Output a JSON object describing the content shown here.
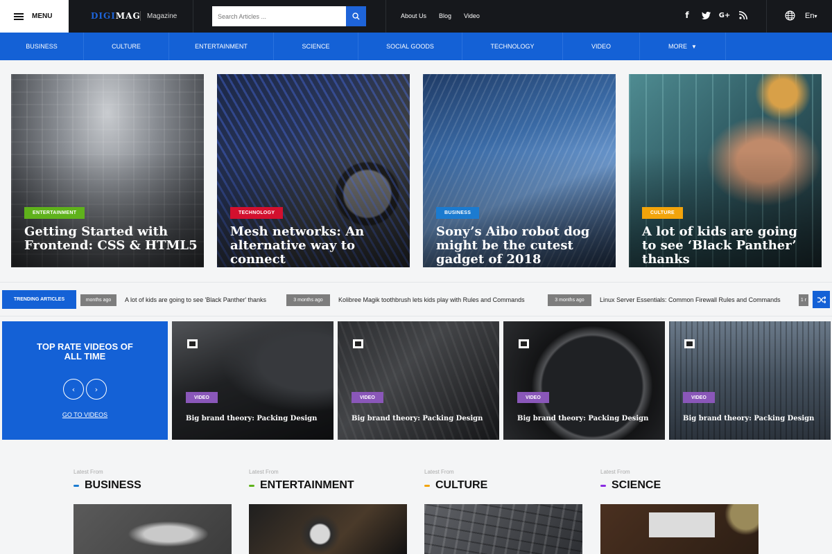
{
  "topbar": {
    "menu_label": "MENU",
    "logo_a": "DIGI",
    "logo_b": "MAG",
    "logo_sub": "Magazine",
    "search_placeholder": "Search Articles ...",
    "links": [
      "About Us",
      "Blog",
      "Video"
    ],
    "social_icons": [
      "facebook-icon",
      "twitter-icon",
      "google-plus-icon",
      "rss-icon"
    ],
    "language": "En"
  },
  "categories": [
    "BUSINESS",
    "CULTURE",
    "ENTERTAINMENT",
    "SCIENCE",
    "SOCIAL GOODS",
    "TECHNOLOGY",
    "VIDEO",
    "MORE"
  ],
  "featured": [
    {
      "badge": "ENTERTAINMENT",
      "badge_color": "#5fb21b",
      "title": "Getting Started with Frontend: CSS & HTML5"
    },
    {
      "badge": "TECHNOLOGY",
      "badge_color": "#d3102e",
      "title": "Mesh networks: An alternative way to connect"
    },
    {
      "badge": "BUSINESS",
      "badge_color": "#1b7bd0",
      "title": "Sony’s Aibo robot dog might be the cutest gadget of 2018"
    },
    {
      "badge": "CULTURE",
      "badge_color": "#f2a40b",
      "title": "A lot of kids are going to see ‘Black Panther’ thanks"
    }
  ],
  "trending": {
    "label": "TRENDING ARTICLES",
    "items": [
      {
        "meta": "months ago",
        "text": "A lot of kids are going to see 'Black Panther' thanks"
      },
      {
        "meta": "3 months ago",
        "text": "Kolibree Magik toothbrush lets kids play with Rules and Commands"
      },
      {
        "meta": "3 months ago",
        "text": "Linux Server Essentials: Common Firewall Rules and Commands"
      },
      {
        "meta": "1 r",
        "text": ""
      }
    ]
  },
  "videos": {
    "promo_title": "TOP RATE VIDEOS OF ALL TIME",
    "go_to": "GO TO VIDEOS",
    "cards": [
      {
        "badge": "VIDEO",
        "title": "Big brand theory: Packing Design"
      },
      {
        "badge": "VIDEO",
        "title": "Big brand theory: Packing Design"
      },
      {
        "badge": "VIDEO",
        "title": "Big brand theory: Packing Design"
      },
      {
        "badge": "VIDEO",
        "title": "Big brand theory: Packing Design"
      }
    ]
  },
  "latest": [
    {
      "label": "Latest From",
      "category": "BUSINESS",
      "color": "#1b7bd0"
    },
    {
      "label": "Latest From",
      "category": "ENTERTAINMENT",
      "color": "#5fb21b"
    },
    {
      "label": "Latest From",
      "category": "CULTURE",
      "color": "#f2a40b"
    },
    {
      "label": "Latest From",
      "category": "SCIENCE",
      "color": "#8a2be2"
    }
  ]
}
